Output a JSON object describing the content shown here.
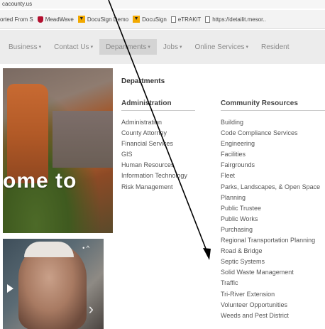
{
  "browser": {
    "url_fragment": "cacounty.us",
    "bookmarks": [
      {
        "label": "orted From S",
        "icon": "none"
      },
      {
        "label": "MeadWave",
        "icon": "shield-icon"
      },
      {
        "label": "DocuSign Demo",
        "icon": "docusign-icon"
      },
      {
        "label": "DocuSign",
        "icon": "docusign-icon"
      },
      {
        "label": "eTRAKiT",
        "icon": "document-icon"
      },
      {
        "label": "https://detailit.mesor..",
        "icon": "document-icon"
      }
    ]
  },
  "nav": {
    "items": [
      {
        "label": "Business",
        "caret": "▾"
      },
      {
        "label": "Contact Us",
        "caret": "▾"
      },
      {
        "label": "Departments",
        "caret": "▾"
      },
      {
        "label": "Jobs",
        "caret": "▾"
      },
      {
        "label": "Online Services",
        "caret": "▾"
      },
      {
        "label": "Resident",
        "caret": ""
      }
    ]
  },
  "hero": {
    "text": "ome to"
  },
  "video": {
    "next_glyph": "›",
    "dots_glyph": "• ^"
  },
  "menu": {
    "title": "Departments",
    "administration": {
      "heading": "Administration",
      "items": [
        "Administration",
        "County Attorney",
        "Financial Services",
        "GIS",
        "Human Resources",
        "Information Technology",
        "Risk Management"
      ]
    },
    "community": {
      "heading": "Community Resources",
      "items": [
        "Building",
        "Code Compliance Services",
        "Engineering",
        "Facilities",
        "Fairgrounds",
        "Fleet",
        "Parks, Landscapes, & Open Space",
        "Planning",
        "Public Trustee",
        "Public Works",
        "Purchasing",
        "Regional Transportation Planning",
        "Road & Bridge",
        "Septic Systems",
        "Solid Waste Management",
        "Traffic",
        "Tri-River Extension",
        "Volunteer Opportunities",
        "Weeds and Pest District"
      ]
    }
  },
  "colors": {
    "nav_bg": "#ececec",
    "active_tab": "#d4d4d4",
    "menu_text": "#555555",
    "arrow": "#000000"
  }
}
